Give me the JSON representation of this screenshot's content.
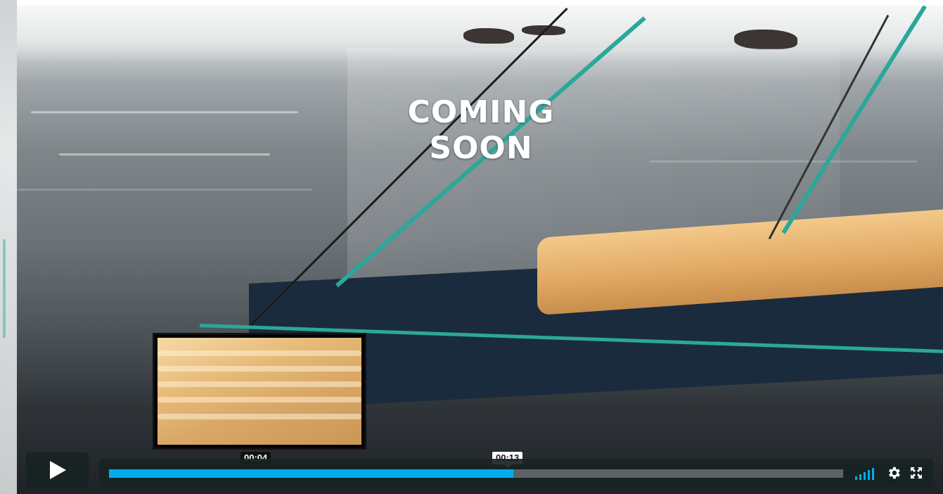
{
  "overlay": {
    "coming_soon": "COMING SOON"
  },
  "player": {
    "play_icon": "play-icon",
    "progress": {
      "played_fraction": 0.551,
      "loaded_fraction": 0.551
    },
    "hover_time": "00:04",
    "current_time": "00:13",
    "volume_icon": "volume-icon",
    "settings_icon": "gear-icon",
    "fullscreen_icon": "fullscreen-icon"
  },
  "colors": {
    "accent": "#00adef",
    "control_bg": "#172322"
  }
}
